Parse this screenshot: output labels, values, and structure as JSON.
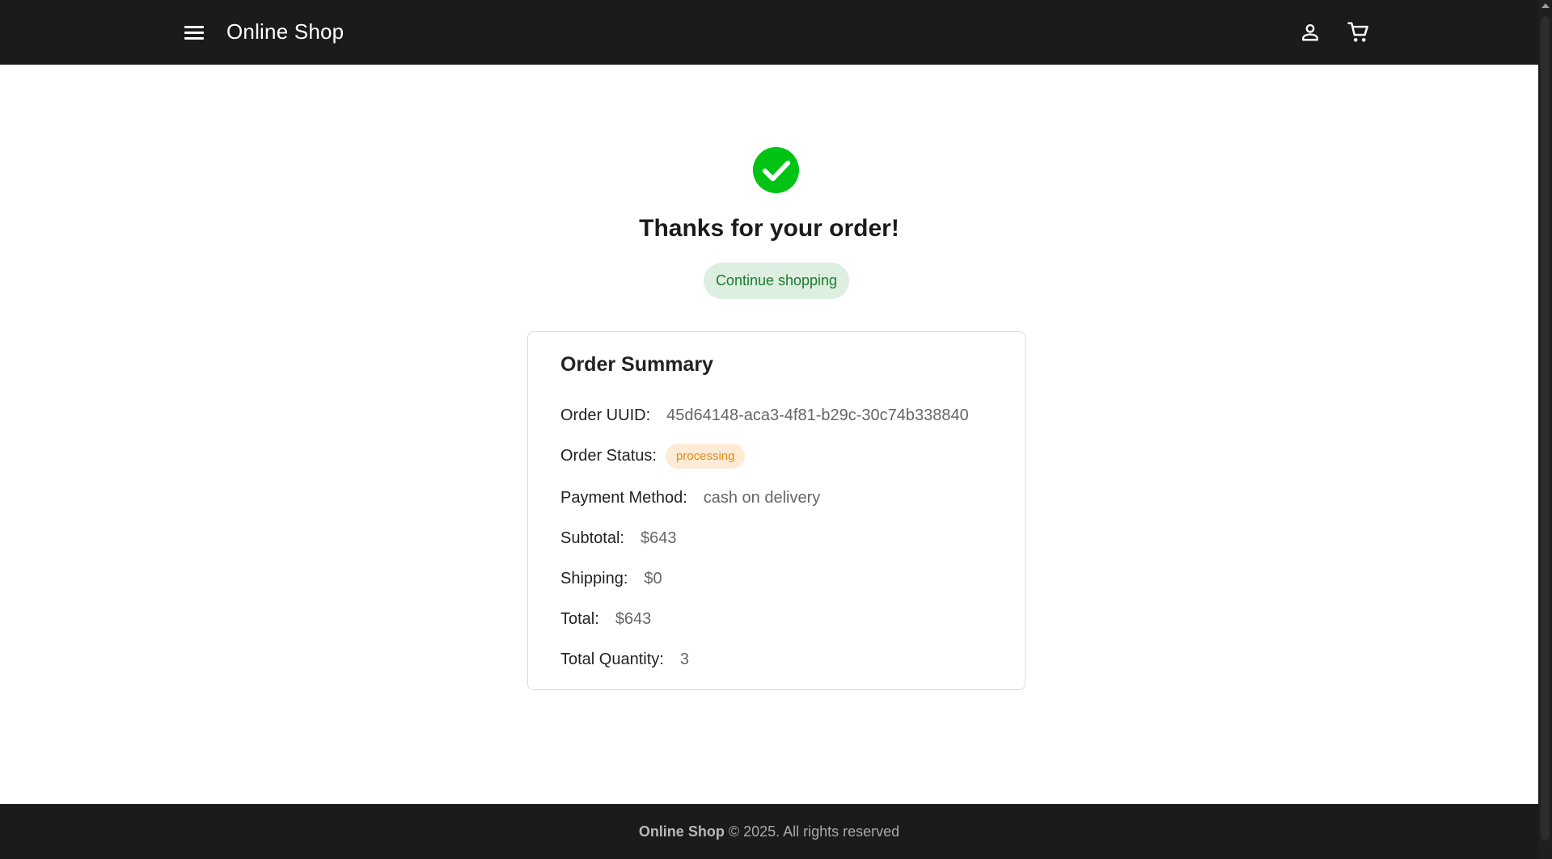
{
  "header": {
    "brand": "Online Shop",
    "menu_icon": "menu-icon",
    "user_icon": "user-icon",
    "cart_icon": "cart-icon"
  },
  "confirmation": {
    "icon": "check-circle-icon",
    "icon_color": "#00c313",
    "headline": "Thanks for your order!",
    "continue_label": "Continue shopping"
  },
  "order_summary": {
    "title": "Order Summary",
    "uuid_label": "Order UUID:",
    "uuid_value": "45d64148-aca3-4f81-b29c-30c74b338840",
    "status_label": "Order Status:",
    "status_value": "processing",
    "payment_label": "Payment Method:",
    "payment_value": "cash on delivery",
    "subtotal_label": "Subtotal:",
    "subtotal_value": "$643",
    "shipping_label": "Shipping:",
    "shipping_value": "$0",
    "total_label": "Total:",
    "total_value": "$643",
    "quantity_label": "Total Quantity:",
    "quantity_value": "3"
  },
  "footer": {
    "brand": "Online Shop",
    "text": "© 2025. All rights reserved"
  },
  "colors": {
    "header_bg": "#1b1b1b",
    "accent_green": "#00c313",
    "button_bg": "#dcefe0",
    "button_text": "#1d7a30",
    "badge_bg": "#fdebd6",
    "badge_text": "#e48a13"
  }
}
